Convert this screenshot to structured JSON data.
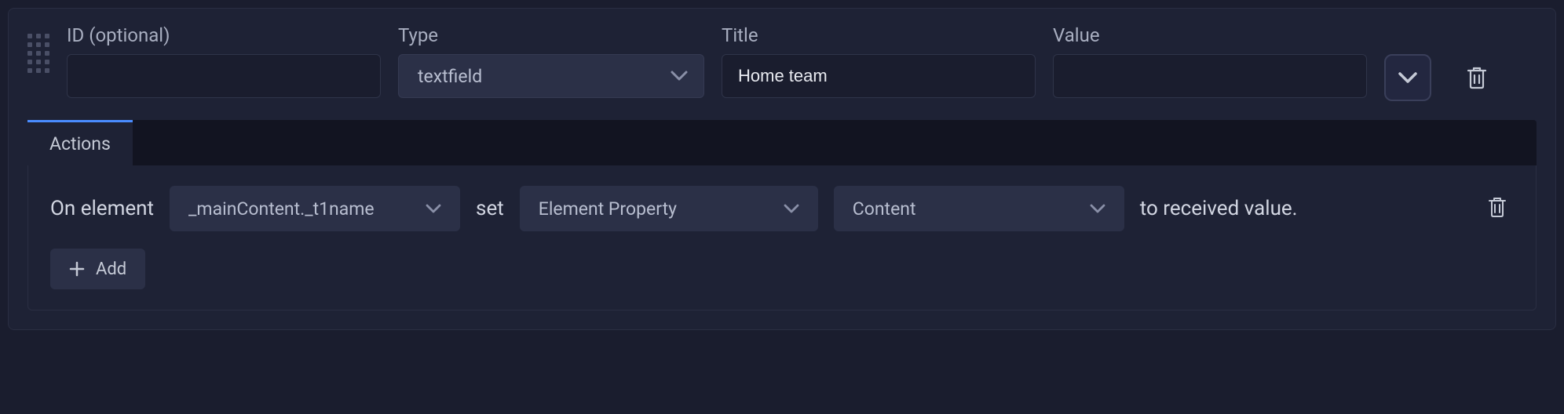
{
  "fields": {
    "id": {
      "label": "ID (optional)",
      "value": ""
    },
    "type": {
      "label": "Type",
      "value": "textfield"
    },
    "title": {
      "label": "Title",
      "value": "Home team"
    },
    "value": {
      "label": "Value",
      "value": ""
    }
  },
  "tabs": {
    "actions": "Actions"
  },
  "action_row": {
    "prefix": "On element",
    "element": "_mainContent._t1name",
    "set": "set",
    "property_type": "Element Property",
    "property": "Content",
    "suffix": "to received value."
  },
  "add_button": "Add"
}
